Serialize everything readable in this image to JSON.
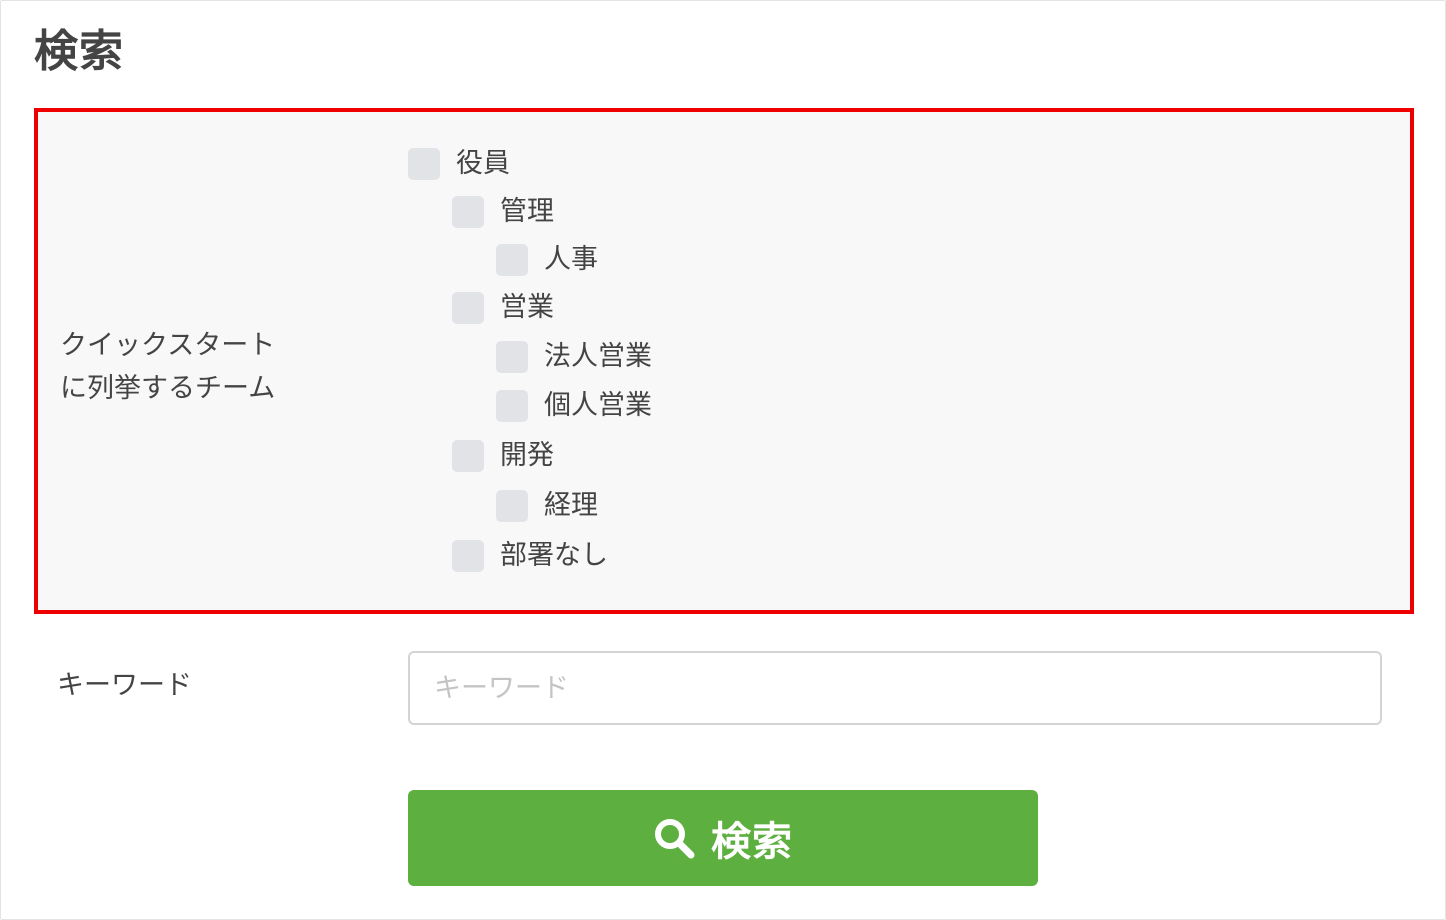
{
  "page": {
    "title": "検索"
  },
  "quick_start": {
    "label_lines": [
      "クイックスタート",
      "に列挙するチーム"
    ],
    "teams": [
      {
        "label": "役員",
        "level": 0,
        "checked": false
      },
      {
        "label": "管理",
        "level": 1,
        "checked": false
      },
      {
        "label": "人事",
        "level": 2,
        "checked": false
      },
      {
        "label": "営業",
        "level": 1,
        "checked": false
      },
      {
        "label": "法人営業",
        "level": 2,
        "checked": false
      },
      {
        "label": "個人営業",
        "level": 2,
        "checked": false
      },
      {
        "label": "開発",
        "level": 1,
        "checked": false
      },
      {
        "label": "経理",
        "level": 2,
        "checked": false
      },
      {
        "label": "部署なし",
        "level": 1,
        "checked": false
      }
    ]
  },
  "keyword": {
    "label": "キーワード",
    "placeholder": "キーワード",
    "value": ""
  },
  "search_button": {
    "label": "検索",
    "icon": "search-icon",
    "color": "#5daf3f"
  },
  "colors": {
    "highlight_border": "#ee0000",
    "checkbox": "#e1e3e6"
  }
}
